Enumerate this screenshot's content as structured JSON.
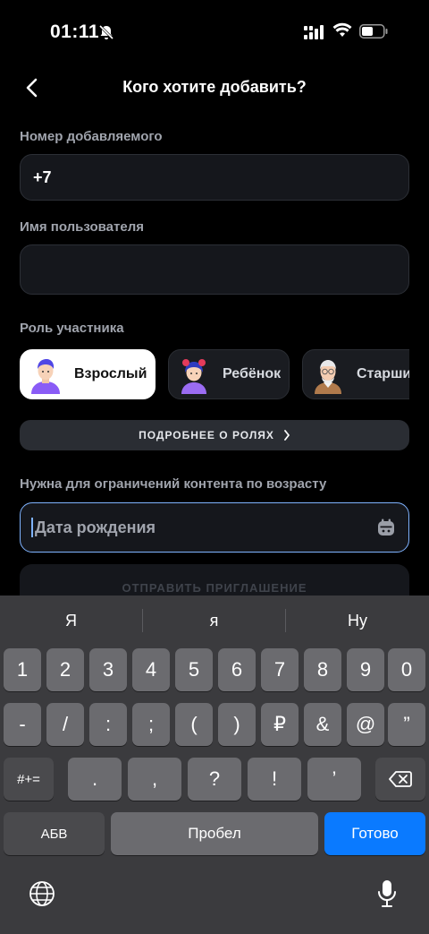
{
  "status": {
    "time": "01:11"
  },
  "header": {
    "title": "Кого хотите добавить?"
  },
  "form": {
    "phone_label": "Номер добавляемого",
    "phone_value": "+7",
    "name_label": "Имя пользователя",
    "name_value": "",
    "role_label": "Роль участника",
    "roles": [
      {
        "label": "Взрослый",
        "selected": true
      },
      {
        "label": "Ребёнок",
        "selected": false
      },
      {
        "label": "Старший",
        "selected": false
      }
    ],
    "roles_more_button": "ПОДРОБНЕЕ О РОЛЯХ",
    "birth_hint": "Нужна для ограничений контента по возрасту",
    "birth_placeholder": "Дата рождения",
    "send_button": "ОТПРАВИТЬ ПРИГЛАШЕНИЕ"
  },
  "keyboard": {
    "suggestions": [
      "Я",
      "я",
      "Ну"
    ],
    "row1": [
      "1",
      "2",
      "3",
      "4",
      "5",
      "6",
      "7",
      "8",
      "9",
      "0"
    ],
    "row2": [
      "-",
      "/",
      ":",
      ";",
      "(",
      ")",
      "₽",
      "&",
      "@",
      "”"
    ],
    "row3": [
      "#+=",
      ".",
      ",",
      "?",
      "!",
      "’"
    ],
    "abc": "АБВ",
    "space": "Пробел",
    "done": "Готово"
  },
  "colors": {
    "accent": "#0a7aff",
    "focus_border": "#7fb3ff",
    "background": "#000000"
  }
}
